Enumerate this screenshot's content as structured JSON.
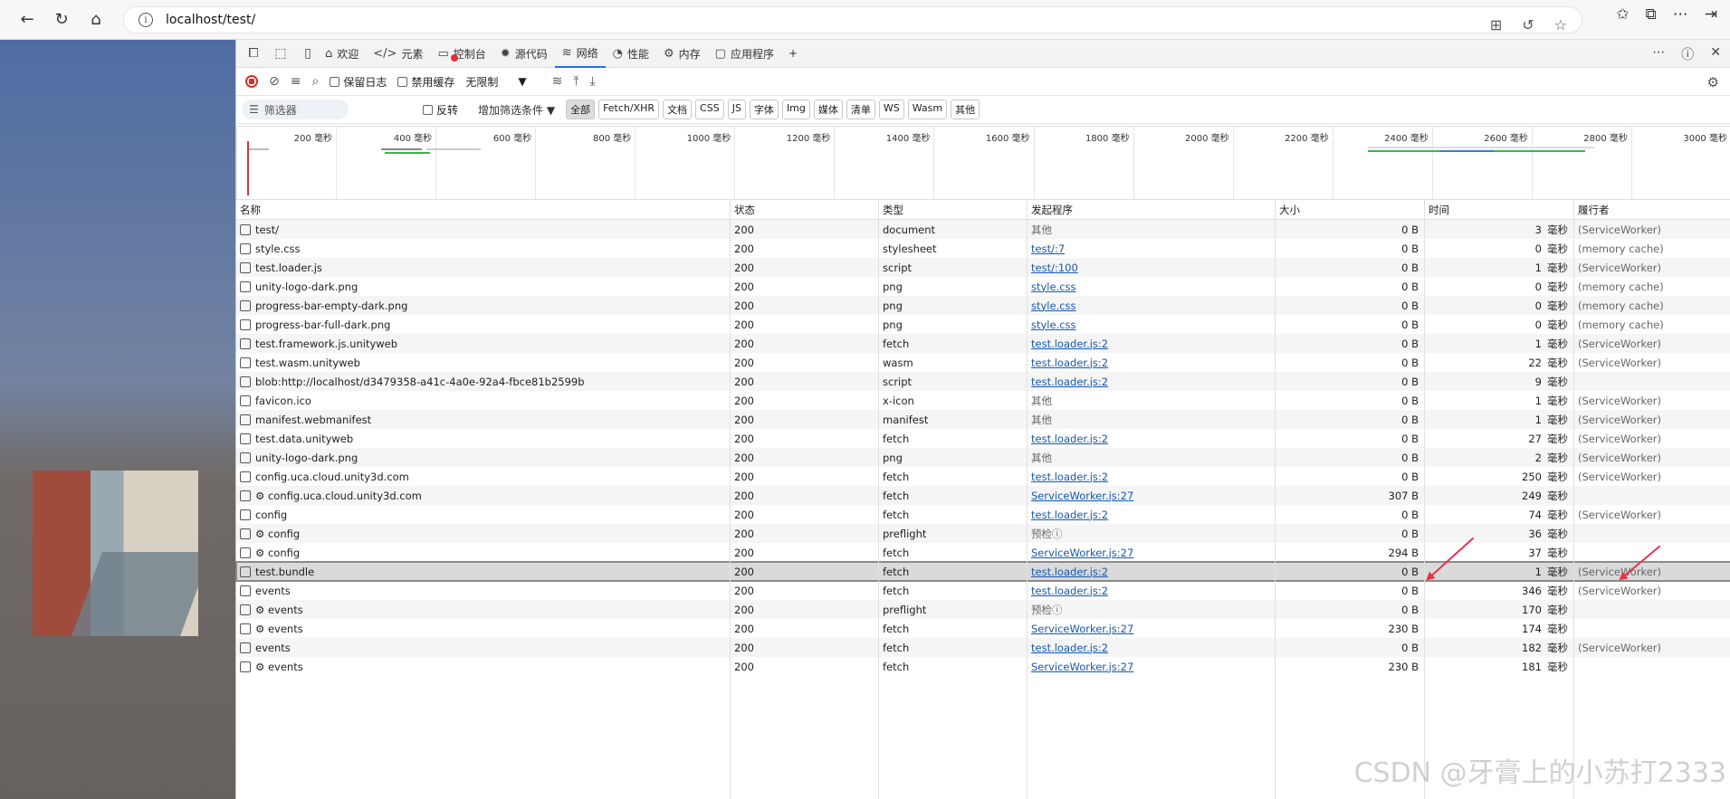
{
  "browser": {
    "url": "localhost/test/",
    "info_glyph": "i"
  },
  "devtools": {
    "tabs": [
      {
        "label": "欢迎",
        "icon": "home-icon"
      },
      {
        "label": "元素",
        "icon": "code-icon"
      },
      {
        "label": "控制台",
        "icon": "console-icon"
      },
      {
        "label": "源代码",
        "icon": "bug-icon"
      },
      {
        "label": "网络",
        "icon": "wifi-icon",
        "active": true
      },
      {
        "label": "性能",
        "icon": "performance-icon"
      },
      {
        "label": "内存",
        "icon": "memory-icon"
      },
      {
        "label": "应用程序",
        "icon": "application-icon"
      }
    ],
    "add_tab": "+",
    "toolbar": {
      "preserve_log": "保留日志",
      "disable_cache": "禁用缓存",
      "throttle": "无限制"
    },
    "filter": {
      "placeholder": "筛选器",
      "invert": "反转",
      "more_filters": "增加筛选条件 ▼",
      "types": [
        "全部",
        "Fetch/XHR",
        "文档",
        "CSS",
        "JS",
        "字体",
        "Img",
        "媒体",
        "清单",
        "WS",
        "Wasm",
        "其他"
      ]
    },
    "overview_labels": [
      "200 毫秒",
      "400 毫秒",
      "600 毫秒",
      "800 毫秒",
      "1000 毫秒",
      "1200 毫秒",
      "1400 毫秒",
      "1600 毫秒",
      "1800 毫秒",
      "2000 毫秒",
      "2200 毫秒",
      "2400 毫秒",
      "2600 毫秒",
      "2800 毫秒",
      "3000 毫秒"
    ],
    "columns": {
      "name": "名称",
      "status": "状态",
      "type": "类型",
      "initiator": "发起程序",
      "size": "大小",
      "time": "时间",
      "fulfilled_by": "履行者"
    },
    "time_unit": "毫秒",
    "rows": [
      {
        "name": "test/",
        "status": "200",
        "type": "document",
        "initiator": "其他",
        "init_link": false,
        "size": "0 B",
        "time": "3",
        "fulfilled_by": "(ServiceWorker)"
      },
      {
        "name": "style.css",
        "status": "200",
        "type": "stylesheet",
        "initiator": "test/:7",
        "init_link": true,
        "size": "0 B",
        "time": "0",
        "fulfilled_by": "(memory cache)"
      },
      {
        "name": "test.loader.js",
        "status": "200",
        "type": "script",
        "initiator": "test/:100",
        "init_link": true,
        "size": "0 B",
        "time": "1",
        "fulfilled_by": "(ServiceWorker)"
      },
      {
        "name": "unity-logo-dark.png",
        "status": "200",
        "type": "png",
        "initiator": "style.css",
        "init_link": true,
        "size": "0 B",
        "time": "0",
        "fulfilled_by": "(memory cache)"
      },
      {
        "name": "progress-bar-empty-dark.png",
        "status": "200",
        "type": "png",
        "initiator": "style.css",
        "init_link": true,
        "size": "0 B",
        "time": "0",
        "fulfilled_by": "(memory cache)"
      },
      {
        "name": "progress-bar-full-dark.png",
        "status": "200",
        "type": "png",
        "initiator": "style.css",
        "init_link": true,
        "size": "0 B",
        "time": "0",
        "fulfilled_by": "(memory cache)"
      },
      {
        "name": "test.framework.js.unityweb",
        "status": "200",
        "type": "fetch",
        "initiator": "test.loader.js:2",
        "init_link": true,
        "size": "0 B",
        "time": "1",
        "fulfilled_by": "(ServiceWorker)"
      },
      {
        "name": "test.wasm.unityweb",
        "status": "200",
        "type": "wasm",
        "initiator": "test.loader.js:2",
        "init_link": true,
        "size": "0 B",
        "time": "22",
        "fulfilled_by": "(ServiceWorker)"
      },
      {
        "name": "blob:http://localhost/d3479358-a41c-4a0e-92a4-fbce81b2599b",
        "status": "200",
        "type": "script",
        "initiator": "test.loader.js:2",
        "init_link": true,
        "size": "0 B",
        "time": "9",
        "fulfilled_by": ""
      },
      {
        "name": "favicon.ico",
        "status": "200",
        "type": "x-icon",
        "initiator": "其他",
        "init_link": false,
        "size": "0 B",
        "time": "1",
        "fulfilled_by": "(ServiceWorker)"
      },
      {
        "name": "manifest.webmanifest",
        "status": "200",
        "type": "manifest",
        "initiator": "其他",
        "init_link": false,
        "size": "0 B",
        "time": "1",
        "fulfilled_by": "(ServiceWorker)"
      },
      {
        "name": "test.data.unityweb",
        "status": "200",
        "type": "fetch",
        "initiator": "test.loader.js:2",
        "init_link": true,
        "size": "0 B",
        "time": "27",
        "fulfilled_by": "(ServiceWorker)"
      },
      {
        "name": "unity-logo-dark.png",
        "status": "200",
        "type": "png",
        "initiator": "其他",
        "init_link": false,
        "size": "0 B",
        "time": "2",
        "fulfilled_by": "(ServiceWorker)"
      },
      {
        "name": "config.uca.cloud.unity3d.com",
        "status": "200",
        "type": "fetch",
        "initiator": "test.loader.js:2",
        "init_link": true,
        "size": "0 B",
        "time": "250",
        "fulfilled_by": "(ServiceWorker)"
      },
      {
        "name": "⚙ config.uca.cloud.unity3d.com",
        "status": "200",
        "type": "fetch",
        "initiator": "ServiceWorker.js:27",
        "init_link": true,
        "size": "307 B",
        "time": "249",
        "fulfilled_by": ""
      },
      {
        "name": "config",
        "status": "200",
        "type": "fetch",
        "initiator": "test.loader.js:2",
        "init_link": true,
        "size": "0 B",
        "time": "74",
        "fulfilled_by": "(ServiceWorker)"
      },
      {
        "name": "⚙ config",
        "status": "200",
        "type": "preflight",
        "initiator": "预检ⓘ",
        "init_link": false,
        "size": "0 B",
        "time": "36",
        "fulfilled_by": ""
      },
      {
        "name": "⚙ config",
        "status": "200",
        "type": "fetch",
        "initiator": "ServiceWorker.js:27",
        "init_link": true,
        "size": "294 B",
        "time": "37",
        "fulfilled_by": ""
      },
      {
        "name": "test.bundle",
        "status": "200",
        "type": "fetch",
        "initiator": "test.loader.js:2",
        "init_link": true,
        "size": "0 B",
        "time": "1",
        "fulfilled_by": "(ServiceWorker)",
        "selected": true
      },
      {
        "name": "events",
        "status": "200",
        "type": "fetch",
        "initiator": "test.loader.js:2",
        "init_link": true,
        "size": "0 B",
        "time": "346",
        "fulfilled_by": "(ServiceWorker)"
      },
      {
        "name": "⚙ events",
        "status": "200",
        "type": "preflight",
        "initiator": "预检ⓘ",
        "init_link": false,
        "size": "0 B",
        "time": "170",
        "fulfilled_by": ""
      },
      {
        "name": "⚙ events",
        "status": "200",
        "type": "fetch",
        "initiator": "ServiceWorker.js:27",
        "init_link": true,
        "size": "230 B",
        "time": "174",
        "fulfilled_by": ""
      },
      {
        "name": "events",
        "status": "200",
        "type": "fetch",
        "initiator": "test.loader.js:2",
        "init_link": true,
        "size": "0 B",
        "time": "182",
        "fulfilled_by": "(ServiceWorker)"
      },
      {
        "name": "⚙ events",
        "status": "200",
        "type": "fetch",
        "initiator": "ServiceWorker.js:27",
        "init_link": true,
        "size": "230 B",
        "time": "181",
        "fulfilled_by": ""
      }
    ]
  },
  "watermark": "CSDN @牙膏上的小苏打2333",
  "colors": {
    "accent": "#1a73e8",
    "record": "#d93025",
    "annotation_arrow": "#e8334a"
  }
}
